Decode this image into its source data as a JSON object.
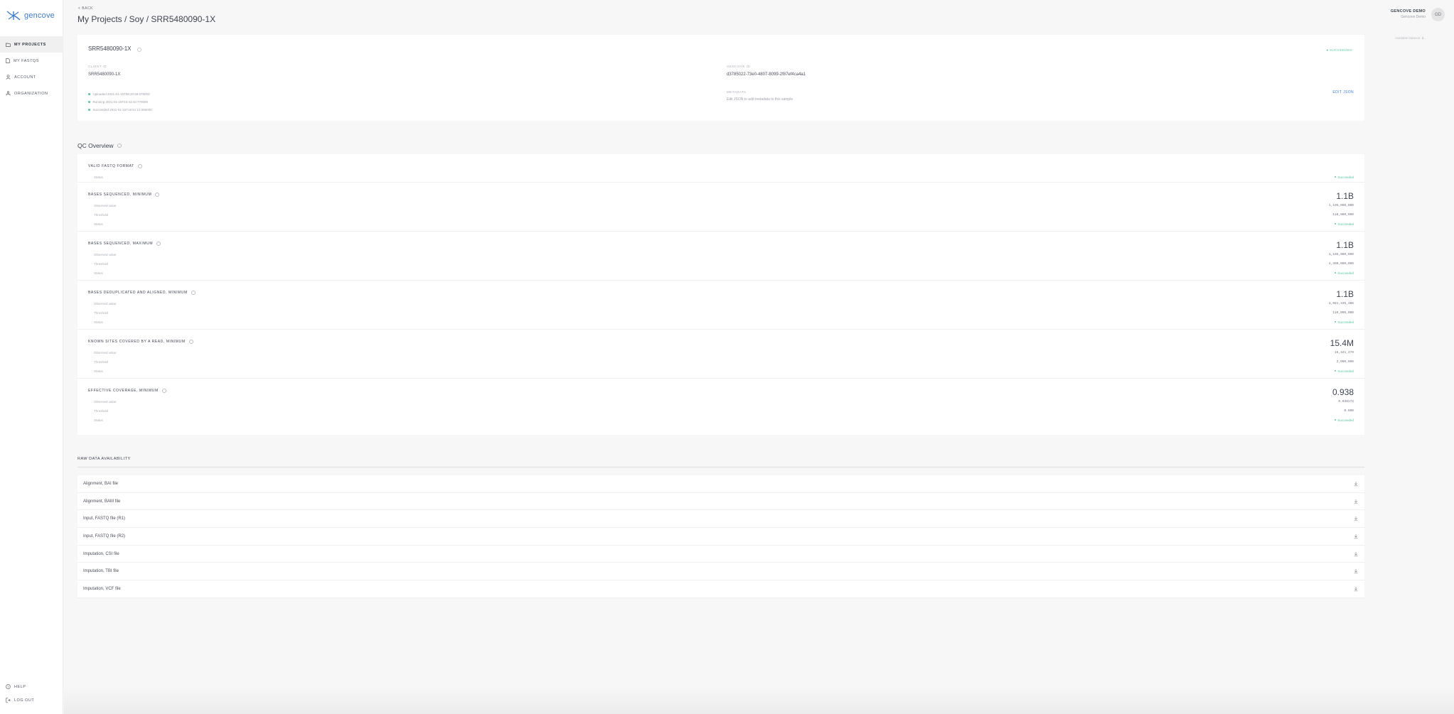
{
  "brand": {
    "name": "gencove",
    "accent": "#3a7bd5",
    "success": "#5ac8a3"
  },
  "sidebar": {
    "items": [
      {
        "label": "MY PROJECTS",
        "icon": "folder-icon",
        "active": true
      },
      {
        "label": "MY FASTQS",
        "icon": "file-icon",
        "active": false
      },
      {
        "label": "ACCOUNT",
        "icon": "user-icon",
        "active": false
      },
      {
        "label": "ORGANIZATION",
        "icon": "org-icon",
        "active": false
      }
    ],
    "bottom": [
      {
        "label": "HELP",
        "icon": "help-icon"
      },
      {
        "label": "LOG OUT",
        "icon": "logout-icon"
      }
    ]
  },
  "header": {
    "back": "< BACK",
    "title": "My Projects / Soy / SRR5480090-1X",
    "user_name": "GENCOVE DEMO",
    "user_org": "Gencove Demo",
    "avatar": "GD",
    "balance": "Available balance: $..."
  },
  "sample": {
    "id": "SRR5480090-1X",
    "status": "● SUCCEEDED",
    "client_id_label": "CLIENT ID",
    "client_id": "SRR5480090-1X",
    "gencove_id_label": "GENCOVE ID",
    "gencove_id": "d3785022-73e0-4807-8099-2f87ef4ca4a1",
    "timeline": [
      "Uploaded 2021-01-15T08:20:58.678000",
      "Running 2021-01-15T10:43:42.770000",
      "Succeeded 2021-01-15T16:51:13.055000"
    ],
    "metadata_label": "METADATA",
    "metadata_hint": "Edit JSON to add metadata to this sample",
    "edit_json": "EDIT JSON"
  },
  "qc": {
    "heading": "QC Overview",
    "sections": [
      {
        "title": "VALID FASTQ FORMAT",
        "big": "",
        "rows": [
          {
            "label": "Status",
            "value": "Succeeded",
            "status": true
          }
        ]
      },
      {
        "title": "BASES SEQUENCED, MINIMUM",
        "big": "1.1B",
        "rows": [
          {
            "label": "Observed value",
            "value": "1,105,000,000"
          },
          {
            "label": "Threshold",
            "value": "110,000,000"
          },
          {
            "label": "Status",
            "value": "Succeeded",
            "status": true
          }
        ]
      },
      {
        "title": "BASES SEQUENCED, MAXIMUM",
        "big": "1.1B",
        "rows": [
          {
            "label": "Observed value",
            "value": "1,105,000,000"
          },
          {
            "label": "Threshold",
            "value": "4,400,000,000"
          },
          {
            "label": "Status",
            "value": "Succeeded",
            "status": true
          }
        ]
      },
      {
        "title": "BASES DEDUPLICATED AND ALIGNED, MINIMUM",
        "big": "1.1B",
        "rows": [
          {
            "label": "Observed value",
            "value": "1,081,435,380"
          },
          {
            "label": "Threshold",
            "value": "110,000,000"
          },
          {
            "label": "Status",
            "value": "Succeeded",
            "status": true
          }
        ]
      },
      {
        "title": "KNOWN SITES COVERED BY A READ, MINIMUM",
        "big": "15.4M",
        "rows": [
          {
            "label": "Observed value",
            "value": "15,421,379"
          },
          {
            "label": "Threshold",
            "value": "2,000,000"
          },
          {
            "label": "Status",
            "value": "Succeeded",
            "status": true
          }
        ]
      },
      {
        "title": "EFFECTIVE COVERAGE, MINIMUM",
        "big": "0.938",
        "rows": [
          {
            "label": "Observed value",
            "value": "0.938174"
          },
          {
            "label": "Threshold",
            "value": "0.900"
          },
          {
            "label": "Status",
            "value": "Succeeded",
            "status": true
          }
        ]
      }
    ]
  },
  "raw": {
    "heading": "RAW DATA AVAILABILITY",
    "items": [
      "Alignment, BAI file",
      "Alignment, BAM file",
      "Input, FASTQ file (R1)",
      "Input, FASTQ file (R2)",
      "Imputation, CSI file",
      "Imputation, TBI file",
      "Imputation, VCF file"
    ]
  }
}
